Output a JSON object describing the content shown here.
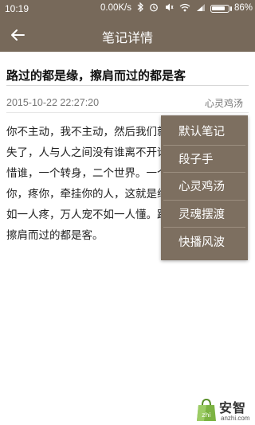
{
  "status_bar": {
    "time": "10:19",
    "speed": "0.00K/s",
    "icons": [
      "bluetooth-icon",
      "alarm-icon",
      "mute-icon",
      "wifi-icon",
      "signal-icon",
      "battery-icon"
    ],
    "battery_level": 0.86,
    "battery_text": "86%"
  },
  "app_bar": {
    "title": "笔记详情",
    "back_icon": "arrow-left-icon"
  },
  "note": {
    "title": "路过的都是缘，擦肩而过的都是客",
    "date": "2015-10-22 22:27:20",
    "category": "心灵鸡汤",
    "lines": [
      "你不主动，我不主动，然后我们就这样消",
      "失了，人与人之间没有谁离不开谁，谁也不",
      "惜谁，一个转身，二个世界。一个对你说的",
      "你，疼你，牵挂你的人，这就是缘，千万人",
      "如一人疼，万人宠不如一人懂。路过的都是缘，",
      "擦肩而过的都是客。"
    ]
  },
  "dropdown": {
    "items": [
      "默认笔记",
      "段子手",
      "心灵鸡汤",
      "灵魂摆渡",
      "快播风波"
    ]
  },
  "watermark": {
    "brand": "安智",
    "url": "anzhi.com",
    "colors": {
      "bag": "#7cb342",
      "text": "#333333"
    }
  },
  "colors": {
    "app_bar": "#77695a",
    "menu_bg": "#7d6f60"
  }
}
